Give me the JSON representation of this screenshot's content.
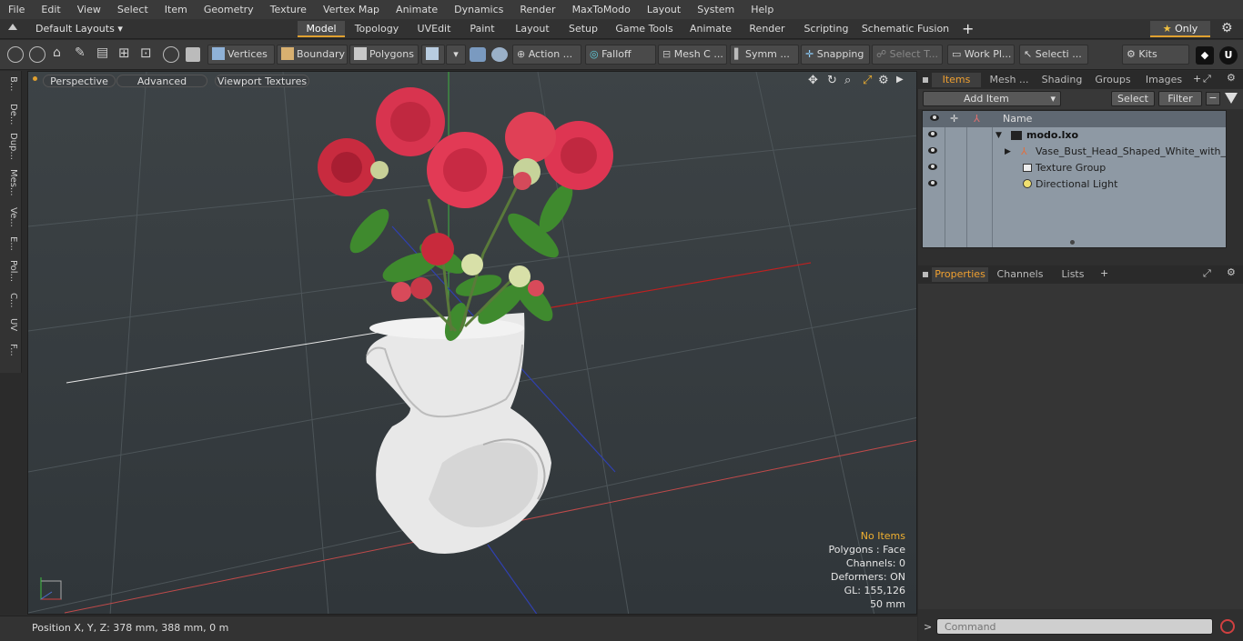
{
  "menu": [
    "File",
    "Edit",
    "View",
    "Select",
    "Item",
    "Geometry",
    "Texture",
    "Vertex Map",
    "Animate",
    "Dynamics",
    "Render",
    "MaxToModo",
    "Layout",
    "System",
    "Help"
  ],
  "layouts": {
    "selector": "Default Layouts",
    "tabs": [
      "Model",
      "Topology",
      "UVEdit",
      "Paint",
      "Layout",
      "Setup",
      "Game Tools",
      "Animate",
      "Render",
      "Scripting",
      "Schematic Fusion"
    ],
    "active": "Model",
    "only_label": "Only"
  },
  "toolbar": {
    "vertices": "Vertices",
    "boundary": "Boundary",
    "polygons": "Polygons",
    "action": "Action",
    "falloff": "Falloff",
    "mesh": "Mesh C ...",
    "symm": "Symm ...",
    "snapping": "Snapping",
    "select_t": "Select T...",
    "work_pl": "Work Pl...",
    "selecti": "Selecti ...",
    "kits": "Kits"
  },
  "left_tabs": [
    "B...",
    "De...",
    "Dup...",
    "Mes...",
    "Ve...",
    "E...",
    "Pol...",
    "C...",
    "UV",
    "F..."
  ],
  "viewport": {
    "buttons": [
      "Perspective",
      "Advanced",
      "Viewport Textures"
    ],
    "info": {
      "no_items": "No Items",
      "polygons": "Polygons : Face",
      "channels": "Channels: 0",
      "deformers": "Deformers: ON",
      "gl": "GL: 155,126",
      "scale": "50 mm"
    }
  },
  "status": {
    "position": "Position X, Y, Z:   378 mm, 388 mm, 0 m"
  },
  "items_panel": {
    "tabs": [
      "Items",
      "Mesh ...",
      "Shading",
      "Groups",
      "Images"
    ],
    "active": "Items",
    "add_item": "Add Item",
    "select": "Select",
    "filter": "Filter",
    "column_name": "Name",
    "tree": [
      {
        "label": "modo.lxo",
        "bold": true
      },
      {
        "label": "Vase_Bust_Head_Shaped_White_with_ ..."
      },
      {
        "label": "Texture Group"
      },
      {
        "label": "Directional Light"
      }
    ]
  },
  "properties_panel": {
    "tabs": [
      "Properties",
      "Channels",
      "Lists"
    ],
    "active": "Properties"
  },
  "command": {
    "placeholder": "Command"
  }
}
